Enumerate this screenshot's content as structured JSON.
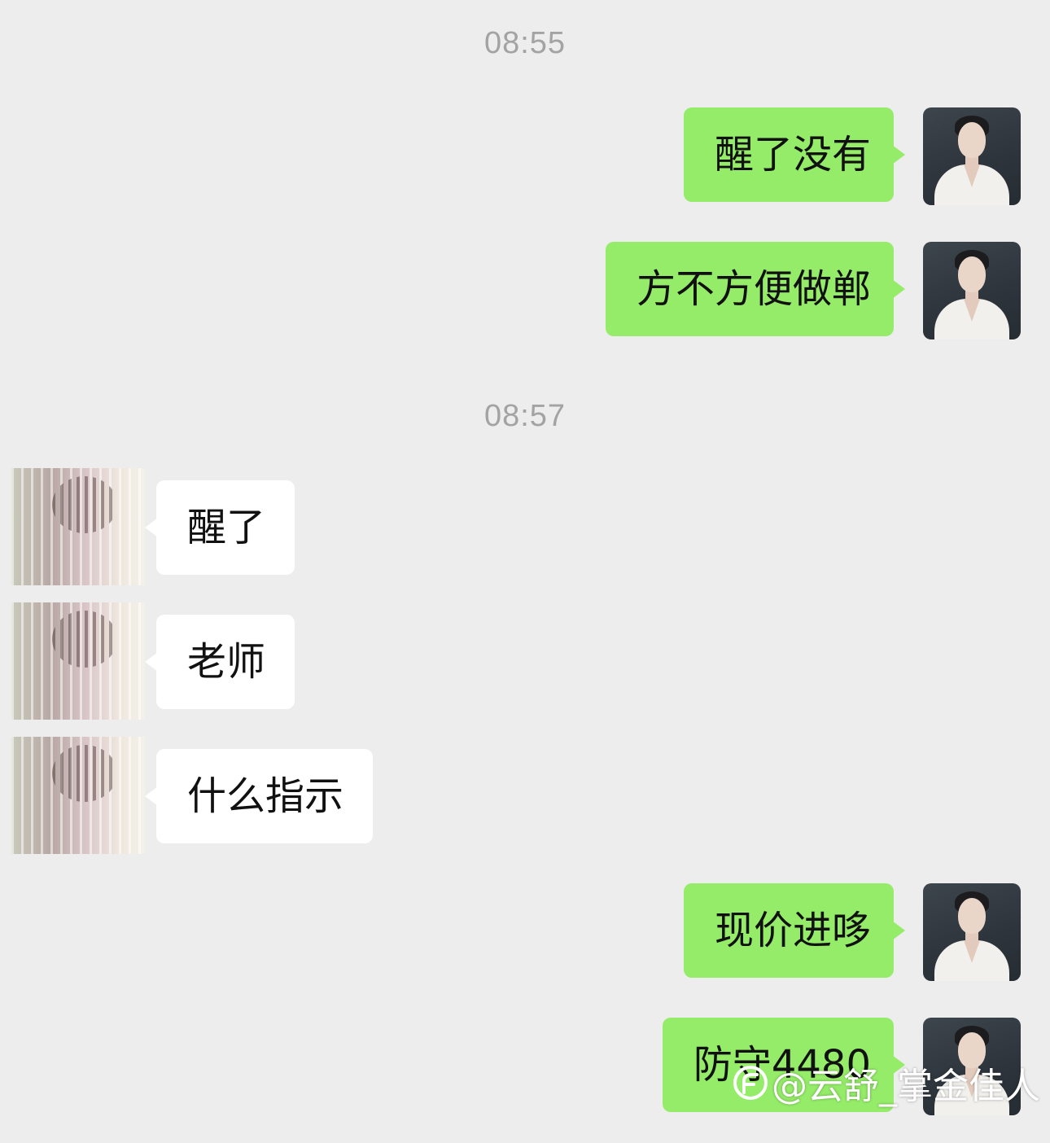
{
  "chat": {
    "timestamps": [
      "08:55",
      "08:57"
    ],
    "messages": [
      {
        "sender": "me",
        "text": "醒了没有"
      },
      {
        "sender": "me",
        "text": "方不方便做郸"
      },
      {
        "sender": "them",
        "text": "醒了"
      },
      {
        "sender": "them",
        "text": "老师"
      },
      {
        "sender": "them",
        "text": "什么指示"
      },
      {
        "sender": "me",
        "text": "现价进哆"
      },
      {
        "sender": "me",
        "text": "防守4480"
      }
    ]
  },
  "watermark": {
    "text": "@云舒_掌金佳人",
    "icon": "xueqiu-logo-icon"
  },
  "colors": {
    "background": "#ededed",
    "my_bubble": "#95ec69",
    "their_bubble": "#ffffff",
    "timestamp": "#a3a3a3"
  }
}
